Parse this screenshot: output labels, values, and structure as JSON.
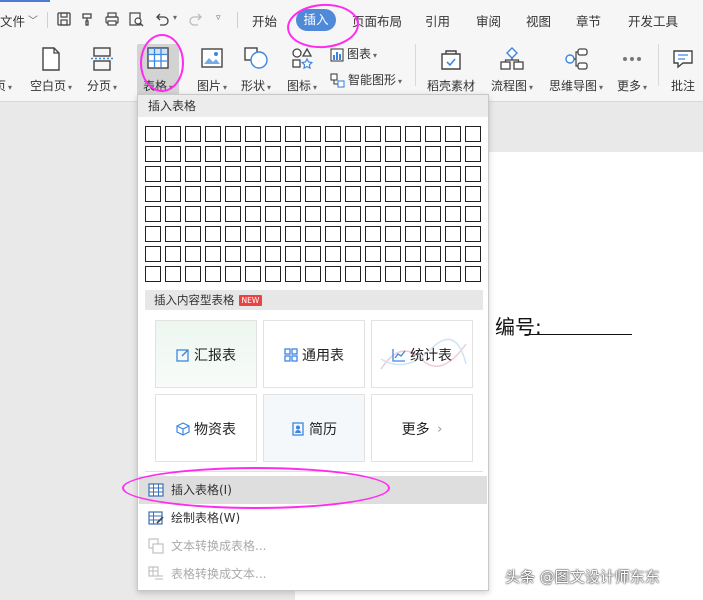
{
  "menubar": {
    "file_label": "文件",
    "tabs": [
      "开始",
      "插入",
      "页面布局",
      "引用",
      "审阅",
      "视图",
      "章节",
      "开发工具"
    ]
  },
  "ribbon": {
    "page_partial": "页",
    "blank_page": "空白页",
    "page_break": "分页",
    "table": "表格",
    "picture": "图片",
    "shape": "形状",
    "icon": "图标",
    "chart": "图表",
    "smart_shape": "智能图形",
    "docer_material": "稻壳素材",
    "flowchart": "流程图",
    "mindmap": "思维导图",
    "more": "更多",
    "comment": "批注"
  },
  "dropdown": {
    "header": "插入表格",
    "grid_rows": 8,
    "grid_cols": 17,
    "content_tables_label": "插入内容型表格",
    "new_badge": "NEW",
    "tiles": {
      "report": "汇报表",
      "general": "通用表",
      "statistics": "统计表",
      "materials": "物资表",
      "resume": "简历",
      "more": "更多"
    },
    "menu": {
      "insert_table": "插入表格(I)",
      "draw_table": "绘制表格(W)",
      "text_to_table": "文本转换成表格...",
      "table_to_text": "表格转换成文本..."
    }
  },
  "document": {
    "visible_text": "编号:"
  },
  "watermark": "头条 @图文设计师东东",
  "colors": {
    "active_tab": "#4f8ad9",
    "annotation": "#ff2cf0",
    "new_badge": "#e94444",
    "icon_blue": "#3d86e0"
  }
}
